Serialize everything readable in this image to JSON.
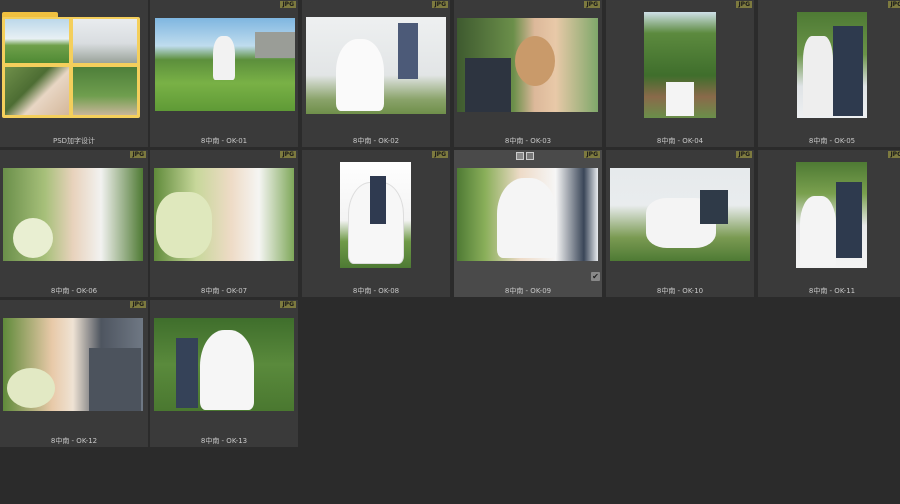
{
  "folder": {
    "label": "PSD加字设计"
  },
  "badge_label": "JPG",
  "files": [
    {
      "name": "8中南 - OK-01"
    },
    {
      "name": "8中南 - OK-02"
    },
    {
      "name": "8中南 - OK-03"
    },
    {
      "name": "8中南 - OK-04"
    },
    {
      "name": "8中南 - OK-05"
    },
    {
      "name": "8中南 - OK-06"
    },
    {
      "name": "8中南 - OK-07"
    },
    {
      "name": "8中南 - OK-08"
    },
    {
      "name": "8中南 - OK-09"
    },
    {
      "name": "8中南 - OK-10"
    },
    {
      "name": "8中南 - OK-11"
    },
    {
      "name": "8中南 - OK-12"
    },
    {
      "name": "8中南 - OK-13"
    }
  ],
  "colors": {
    "cell_bg": "#3a3a3a",
    "page_bg": "#2b2b2b",
    "badge_bg": "#7d7a3f",
    "folder": "#f4cf5c"
  },
  "selected_index": 8
}
